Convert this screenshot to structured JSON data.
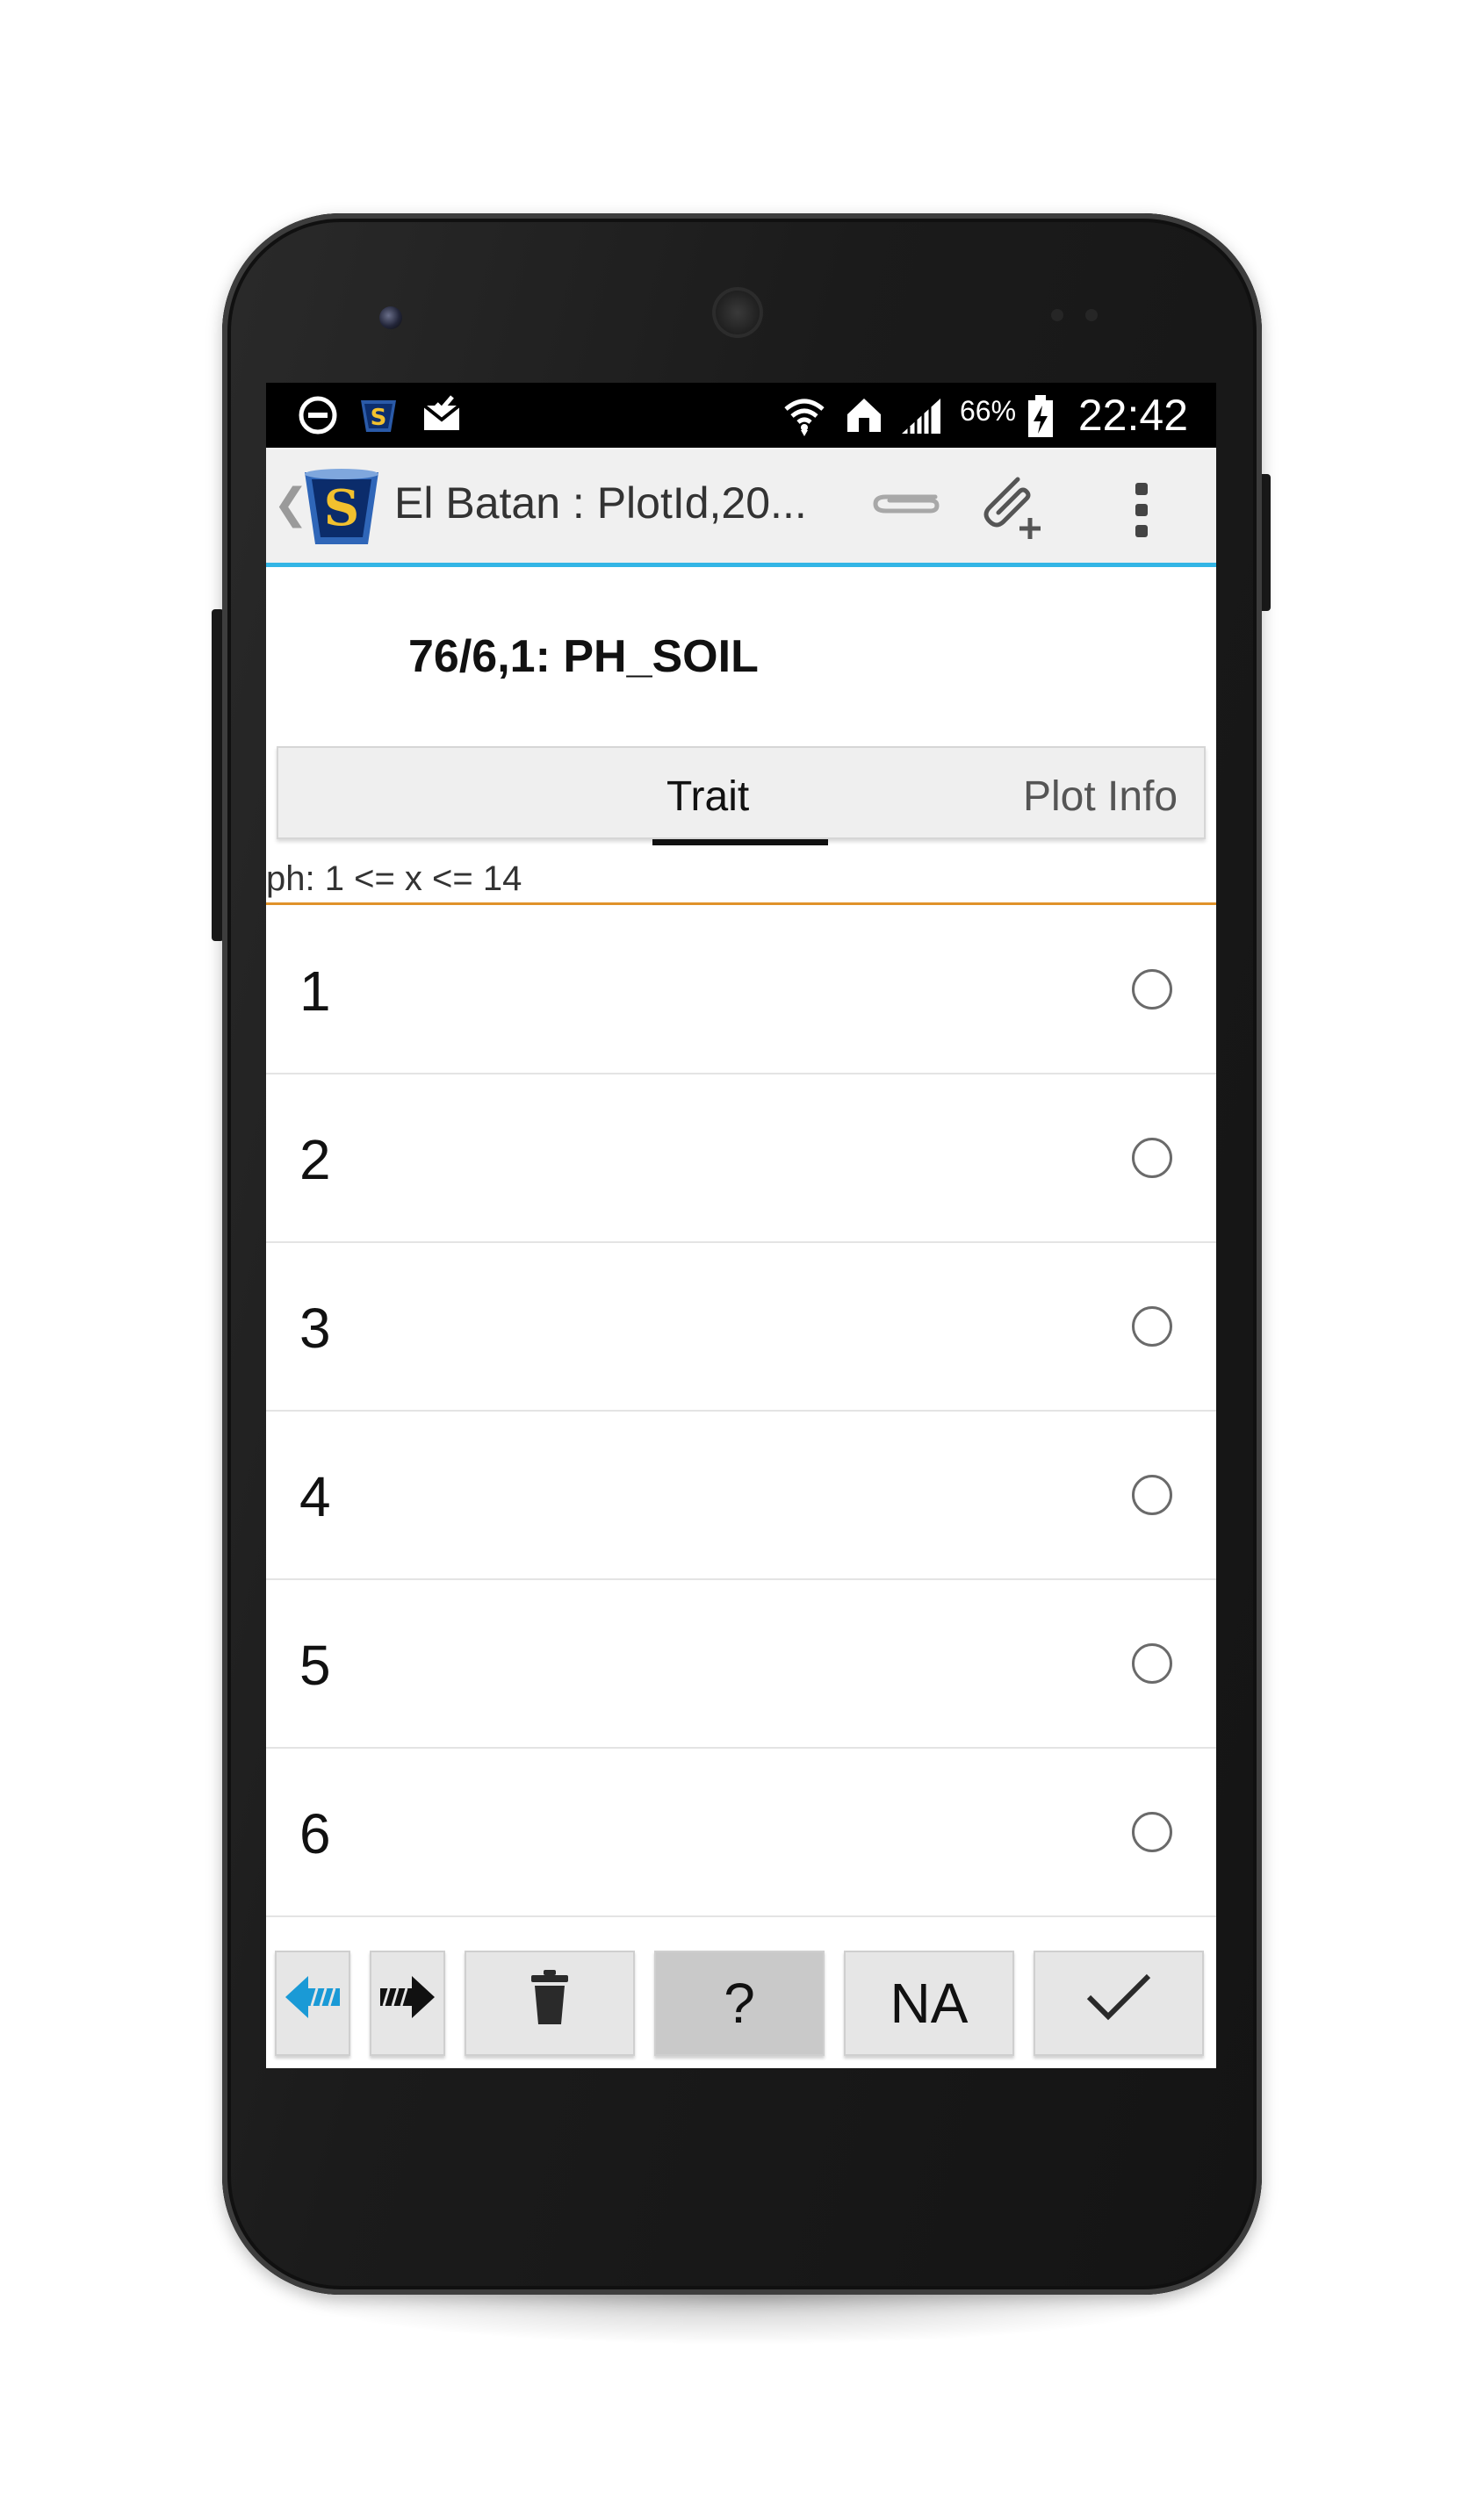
{
  "status_bar": {
    "battery_percent": "66%",
    "time": "22:42",
    "icons": [
      "do-not-disturb-icon",
      "app-notification-icon",
      "mail-icon",
      "wifi-icon",
      "home-icon",
      "signal-icon",
      "battery-charging-icon"
    ]
  },
  "action_bar": {
    "title": "El Batan : PlotId,20...",
    "back_glyph": "❮",
    "icons": [
      "app-logo",
      "attachment-icon",
      "add-attachment-icon",
      "overflow-menu-icon"
    ]
  },
  "heading": "76/6,1: PH_SOIL",
  "tabs": [
    {
      "label": "Trait",
      "selected": true
    },
    {
      "label": "Plot Info",
      "selected": false
    }
  ],
  "constraint_text": "ph: 1 <= x <= 14",
  "options": [
    {
      "label": "1",
      "selected": false
    },
    {
      "label": "2",
      "selected": false
    },
    {
      "label": "3",
      "selected": false
    },
    {
      "label": "4",
      "selected": false
    },
    {
      "label": "5",
      "selected": false
    },
    {
      "label": "6",
      "selected": false
    }
  ],
  "toolbar": {
    "buttons": [
      {
        "name": "previous-button",
        "icon": "arrow-left-icon"
      },
      {
        "name": "next-button",
        "icon": "arrow-right-icon"
      },
      {
        "name": "delete-button",
        "icon": "trash-icon"
      },
      {
        "name": "unknown-button",
        "label": "?"
      },
      {
        "name": "na-button",
        "label": "NA"
      },
      {
        "name": "confirm-button",
        "icon": "checkmark-icon"
      }
    ]
  },
  "colors": {
    "accent": "#33b5e5",
    "divider_orange": "#e0922a",
    "status_bar_bg": "#000000",
    "action_bar_bg": "#f0f0f0"
  }
}
